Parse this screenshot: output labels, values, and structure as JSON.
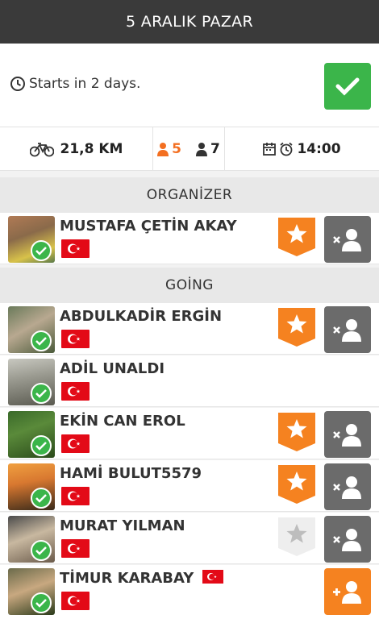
{
  "header": {
    "title": "5 ARALIK PAZAR"
  },
  "status": {
    "text": "Starts in 2 days."
  },
  "stats": {
    "distance": "21,8 KM",
    "going_count": "5",
    "total_count": "7",
    "time": "14:00"
  },
  "sections": {
    "organizer": "ORGANİZER",
    "going": "GOİNG"
  },
  "colors": {
    "accent": "#f36f21",
    "success": "#3bb54a",
    "header": "#3a3a3a",
    "flag_red": "#e30a17"
  },
  "organizer": [
    {
      "name": "MUSTAFA ÇETİN AKAY",
      "badge": "star-orange",
      "action": "remove-friend"
    }
  ],
  "going": [
    {
      "name": "ABDULKADİR ERGİN",
      "badge": "star-orange",
      "action": "remove-friend"
    },
    {
      "name": "ADİL UNALDI",
      "badge": "none",
      "action": "none"
    },
    {
      "name": "EKİN CAN EROL",
      "badge": "star-orange",
      "action": "remove-friend"
    },
    {
      "name": "HAMİ BULUT5579",
      "badge": "star-orange",
      "action": "remove-friend"
    },
    {
      "name": "MURAT YILMAN",
      "badge": "star-gray",
      "action": "remove-friend"
    },
    {
      "name": "TİMUR KARABAY",
      "badge": "none",
      "action": "add-friend"
    }
  ]
}
